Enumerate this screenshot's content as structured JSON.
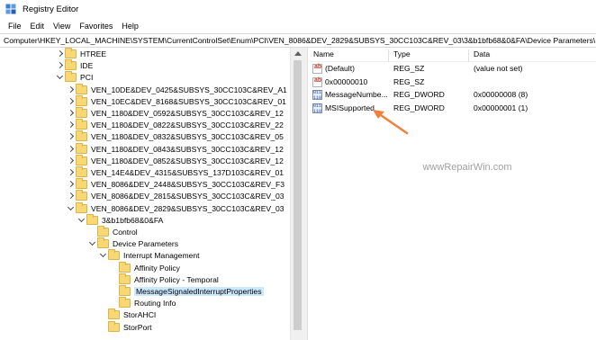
{
  "window": {
    "title": "Registry Editor"
  },
  "menu": [
    "File",
    "Edit",
    "View",
    "Favorites",
    "Help"
  ],
  "address": "Computer\\HKEY_LOCAL_MACHINE\\SYSTEM\\CurrentControlSet\\Enum\\PCI\\VEN_8086&DEV_2829&SUBSYS_30CC103C&REV_03\\3&b1bfb68&0&FA\\Device Parameters\\Interrupt Management\\MessageSignaledInterruptProperties",
  "tree": [
    {
      "label": "HTREE",
      "indent": 0,
      "chevron": "right"
    },
    {
      "label": "IDE",
      "indent": 0,
      "chevron": "right"
    },
    {
      "label": "PCI",
      "indent": 0,
      "chevron": "down"
    },
    {
      "label": "VEN_10DE&DEV_0425&SUBSYS_30CC103C&REV_A1",
      "indent": 1,
      "chevron": "right"
    },
    {
      "label": "VEN_10EC&DEV_8168&SUBSYS_30CC103C&REV_01",
      "indent": 1,
      "chevron": "right"
    },
    {
      "label": "VEN_1180&DEV_0592&SUBSYS_30CC103C&REV_12",
      "indent": 1,
      "chevron": "right"
    },
    {
      "label": "VEN_1180&DEV_0822&SUBSYS_30CC103C&REV_22",
      "indent": 1,
      "chevron": "right"
    },
    {
      "label": "VEN_1180&DEV_0832&SUBSYS_30CC103C&REV_05",
      "indent": 1,
      "chevron": "right"
    },
    {
      "label": "VEN_1180&DEV_0843&SUBSYS_30CC103C&REV_12",
      "indent": 1,
      "chevron": "right"
    },
    {
      "label": "VEN_1180&DEV_0852&SUBSYS_30CC103C&REV_12",
      "indent": 1,
      "chevron": "right"
    },
    {
      "label": "VEN_14E4&DEV_4315&SUBSYS_137D103C&REV_01",
      "indent": 1,
      "chevron": "right"
    },
    {
      "label": "VEN_8086&DEV_2448&SUBSYS_30CC103C&REV_F3",
      "indent": 1,
      "chevron": "right"
    },
    {
      "label": "VEN_8086&DEV_2815&SUBSYS_30CC103C&REV_03",
      "indent": 1,
      "chevron": "right"
    },
    {
      "label": "VEN_8086&DEV_2829&SUBSYS_30CC103C&REV_03",
      "indent": 1,
      "chevron": "down"
    },
    {
      "label": "3&b1bfb68&0&FA",
      "indent": 2,
      "chevron": "down"
    },
    {
      "label": "Control",
      "indent": 3,
      "chevron": ""
    },
    {
      "label": "Device Parameters",
      "indent": 3,
      "chevron": "down"
    },
    {
      "label": "Interrupt Management",
      "indent": 4,
      "chevron": "down"
    },
    {
      "label": "Affinity Policy",
      "indent": 5,
      "chevron": ""
    },
    {
      "label": "Affinity Policy - Temporal",
      "indent": 5,
      "chevron": ""
    },
    {
      "label": "MessageSignaledInterruptProperties",
      "indent": 5,
      "chevron": "",
      "selected": true
    },
    {
      "label": "Routing Info",
      "indent": 5,
      "chevron": ""
    },
    {
      "label": "StorAHCI",
      "indent": 4,
      "chevron": ""
    },
    {
      "label": "StorPort",
      "indent": 4,
      "chevron": ""
    }
  ],
  "list": {
    "headers": {
      "name": "Name",
      "type": "Type",
      "data": "Data"
    },
    "rows": [
      {
        "icon": "string-value-icon",
        "name": "(Default)",
        "type": "REG_SZ",
        "data": "(value not set)"
      },
      {
        "icon": "string-value-icon",
        "name": "0x00000010",
        "type": "REG_SZ",
        "data": ""
      },
      {
        "icon": "binary-value-icon",
        "name": "MessageNumbe...",
        "type": "REG_DWORD",
        "data": "0x00000008 (8)"
      },
      {
        "icon": "binary-value-icon",
        "name": "MSISupported",
        "type": "REG_DWORD",
        "data": "0x00000001 (1)"
      }
    ]
  },
  "watermark": "wwwRepairWin.com",
  "colors": {
    "selection": "#cce8ff",
    "folder": "#f8d775",
    "arrow": "#f0803c"
  }
}
